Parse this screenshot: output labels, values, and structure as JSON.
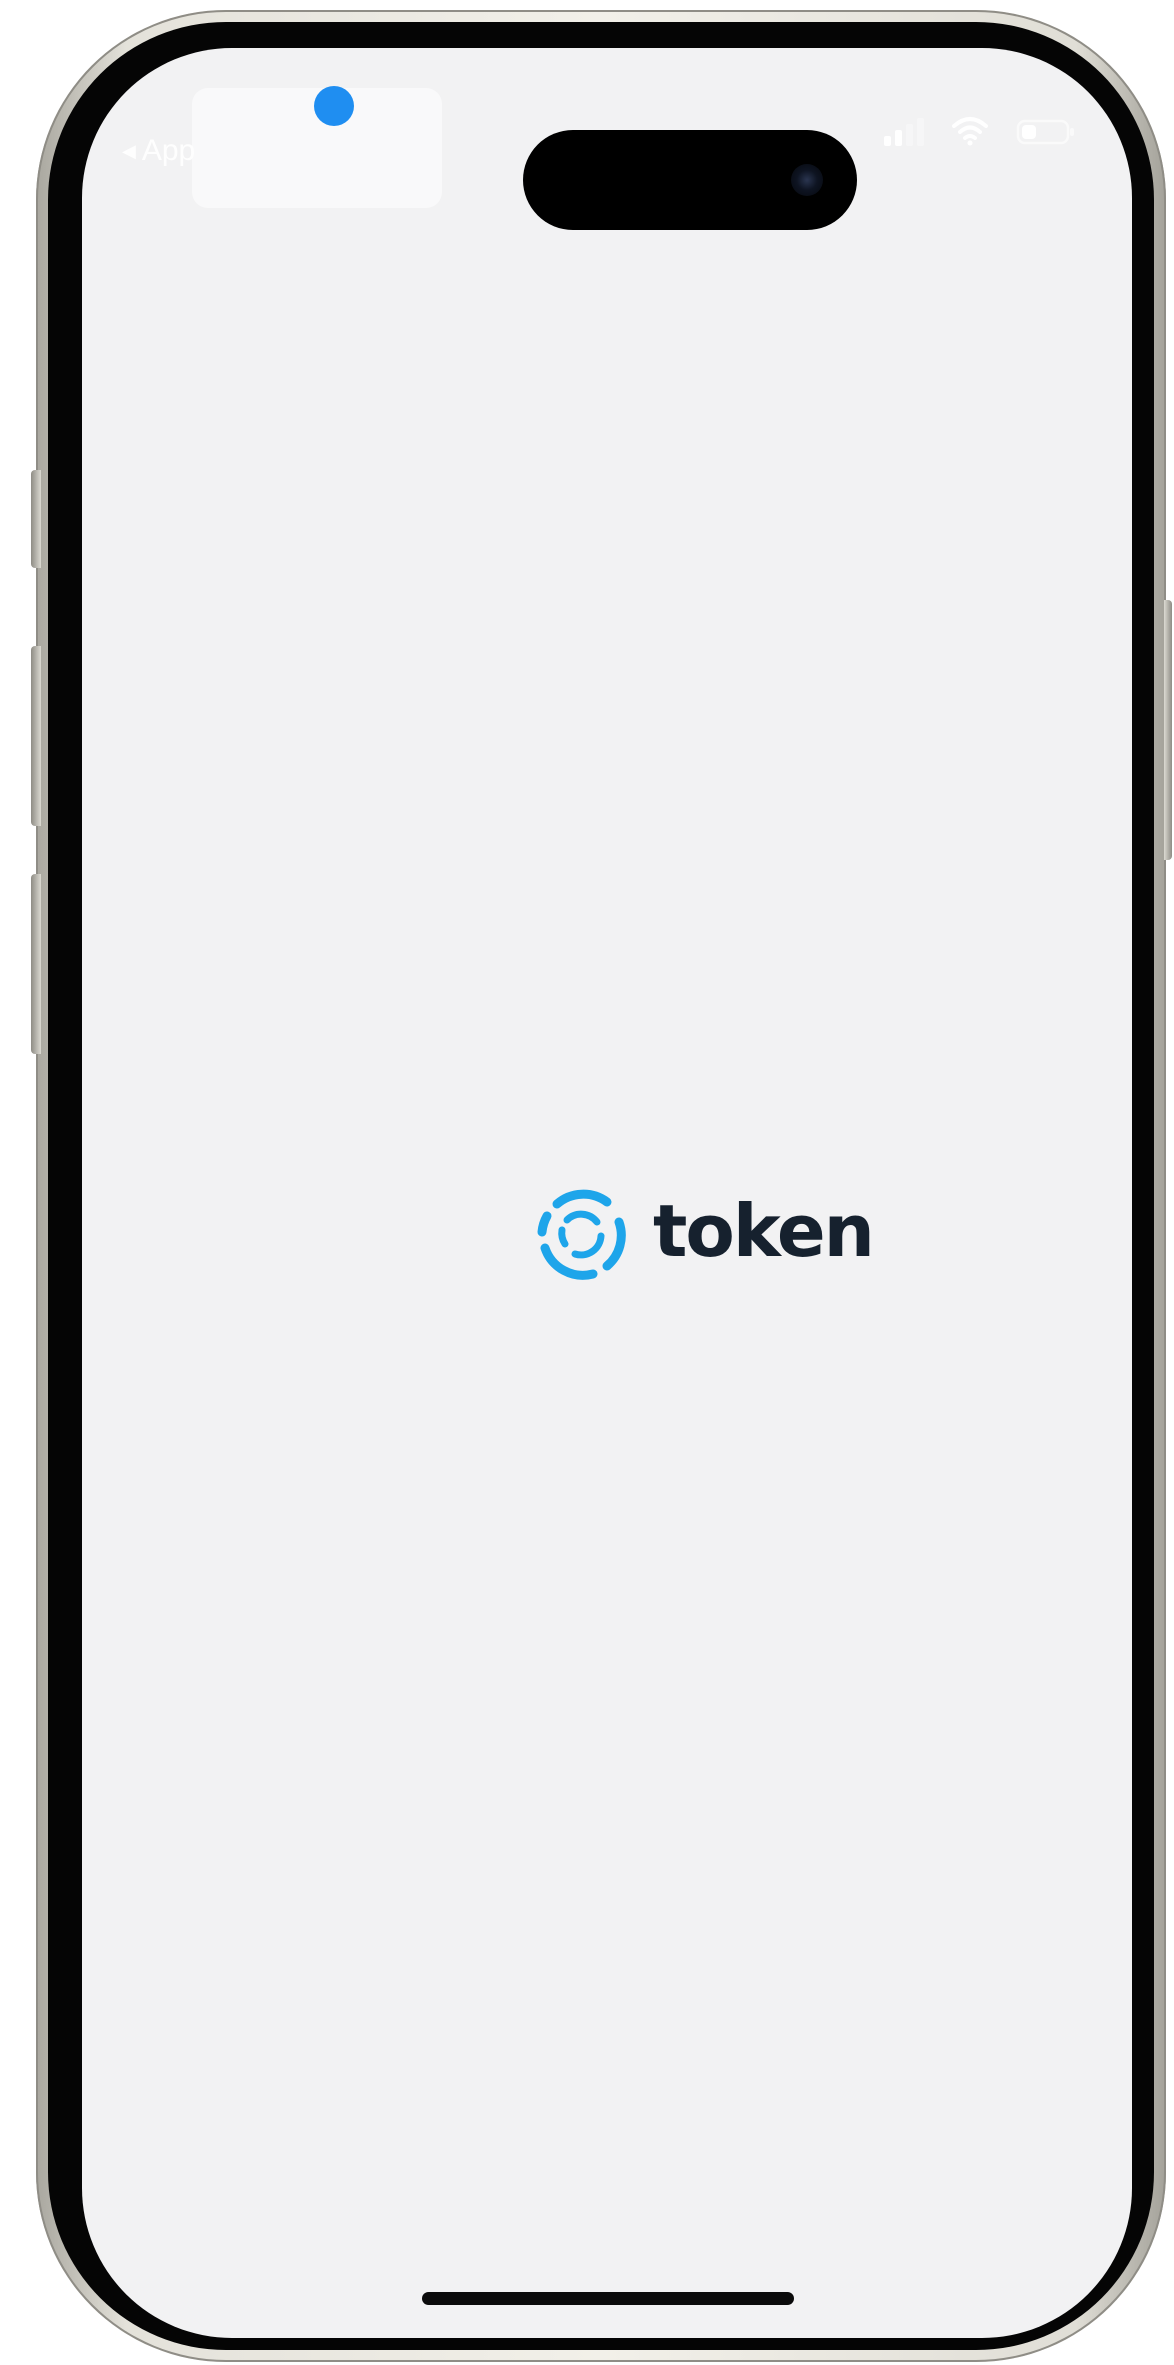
{
  "status_bar": {
    "back_label": "App",
    "back_arrow": "◀"
  },
  "icons": {
    "back": "back-arrow-icon",
    "signal": "cellular-signal-icon",
    "wifi": "wifi-icon",
    "battery": "battery-icon",
    "logo": "token-logo-icon"
  },
  "splash": {
    "brand_name": "token"
  },
  "colors": {
    "screen_background": "#f2f2f3",
    "brand_blue": "#1ea5ea",
    "brand_text": "#16212e",
    "notification_dot": "#1f8ef1"
  }
}
